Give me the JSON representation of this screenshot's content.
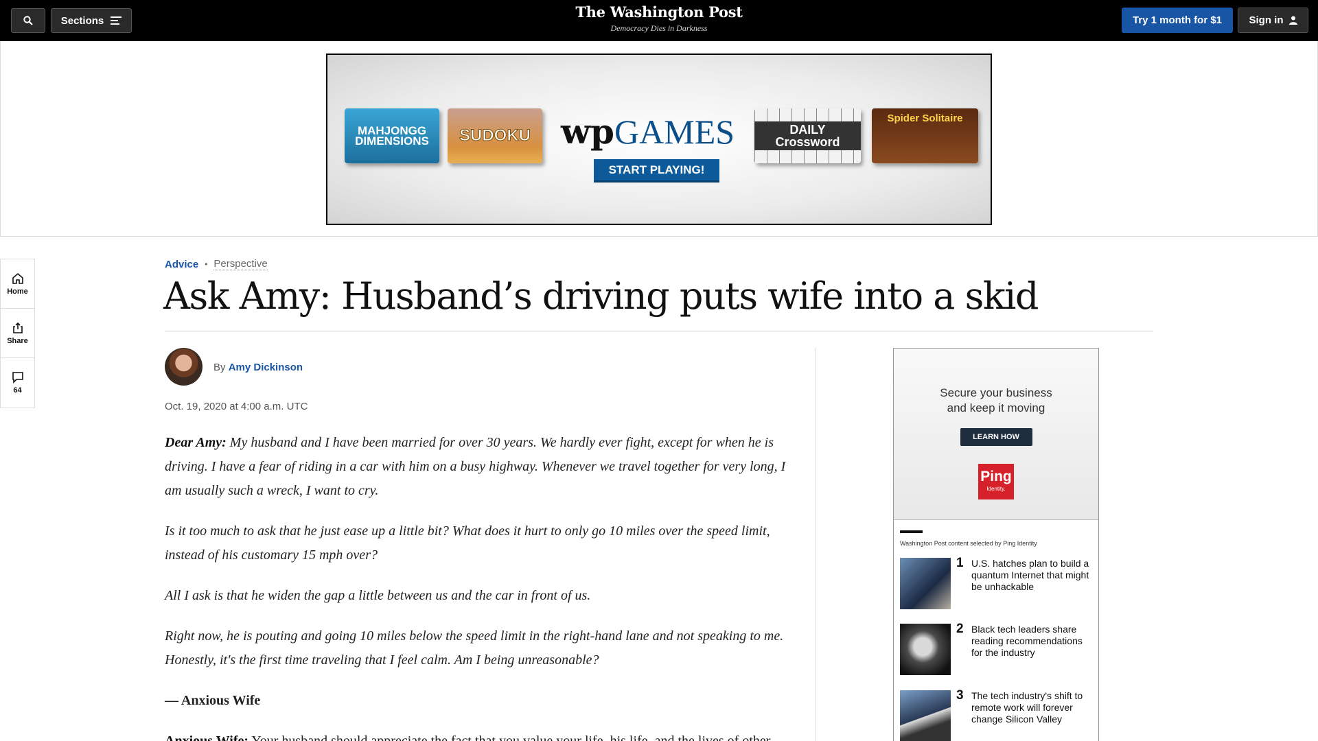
{
  "header": {
    "sections_label": "Sections",
    "logo": "The Washington Post",
    "tagline": "Democracy Dies in Darkness",
    "subscribe_label": "Try 1 month for $1",
    "signin_label": "Sign in"
  },
  "ad_banner": {
    "games": [
      "MAHJONGG DIMENSIONS",
      "SUDOKU",
      "DAILY Crossword",
      "Spider Solitaire"
    ],
    "brand_mark": "wp",
    "brand_word": "GAMES",
    "cta": "START PLAYING!"
  },
  "rail": {
    "home_label": "Home",
    "share_label": "Share",
    "comments_count": "64"
  },
  "article": {
    "kicker": "Advice",
    "label": "Perspective",
    "headline": "Ask Amy: Husband’s driving puts wife into a skid",
    "by": "By",
    "author": "Amy Dickinson",
    "date": "Oct. 19, 2020 at 4:00 a.m. UTC",
    "salutation": "Dear Amy:",
    "p1": " My husband and I have been married for over 30 years. We hardly ever fight, except for when he is driving. I have a fear of riding in a car with him on a busy highway. Whenever we travel together for very long, I am usually such a wreck, I want to cry.",
    "p2": "Is it too much to ask that he just ease up a little bit? What does it hurt to only go 10 miles over the speed limit, instead of his customary 15 mph over?",
    "p3": "All I ask is that he widen the gap a little between us and the car in front of us.",
    "p4": "Right now, he is pouting and going 10 miles below the speed limit in the right-hand lane and not speaking to me. Honestly, it's the first time traveling that I feel calm. Am I being unreasonable?",
    "signoff": "— Anxious Wife",
    "reply_salutation": "Anxious Wife:",
    "reply_start": " Your husband should appreciate the fact that you value your life, his life, and the lives of other"
  },
  "sidebar_ad": {
    "headline_line1": "Secure your business",
    "headline_line2": "and keep it moving",
    "cta": "LEARN HOW",
    "logo": "Ping",
    "logo_sub": "Identity.",
    "note": "Washington Post content selected by Ping Identity",
    "stories": [
      {
        "num": "1",
        "title": "U.S. hatches plan to build a quantum Internet that might be unhackable"
      },
      {
        "num": "2",
        "title": "Black tech leaders share reading recommendations for the industry"
      },
      {
        "num": "3",
        "title": "The tech industry's shift to remote work will forever change Silicon Valley"
      }
    ]
  },
  "colors": {
    "brand_blue": "#1955a5",
    "header_bg": "#000000",
    "ping_red": "#d6202a"
  }
}
